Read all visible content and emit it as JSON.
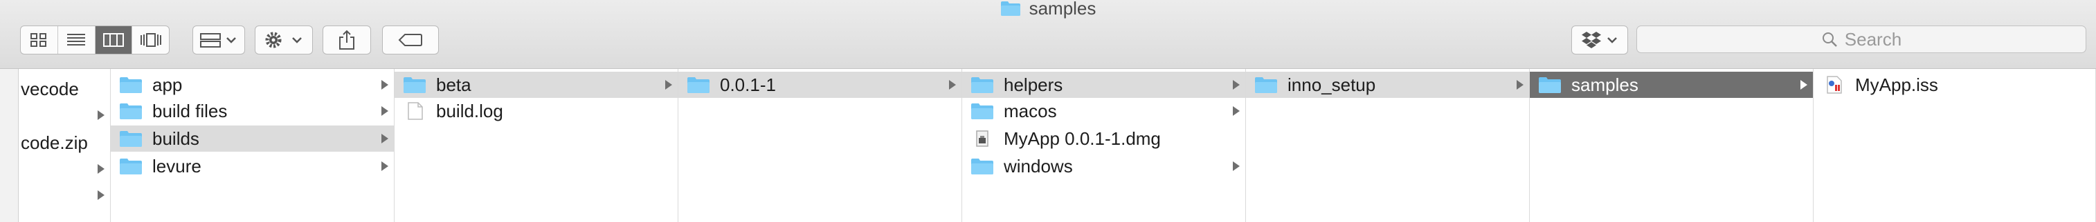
{
  "window": {
    "title": "samples"
  },
  "toolbar": {
    "views": [
      "icon-view",
      "list-view",
      "column-view",
      "cover-flow-view"
    ],
    "active_view": "column-view",
    "search_placeholder": "Search"
  },
  "columns": {
    "col0": [
      {
        "label": "vecode",
        "arrow": false
      },
      {
        "label": "",
        "arrow": true
      },
      {
        "label": "code.zip",
        "arrow": false
      },
      {
        "label": "",
        "arrow": true
      },
      {
        "label": "",
        "arrow": true
      }
    ],
    "col1": [
      {
        "label": "app",
        "icon": "folder-icon",
        "arrow": true
      },
      {
        "label": "build files",
        "icon": "folder-icon",
        "arrow": true
      },
      {
        "label": "builds",
        "icon": "folder-icon",
        "arrow": true,
        "selected": "gray"
      },
      {
        "label": "levure",
        "icon": "folder-icon",
        "arrow": true
      }
    ],
    "col2": [
      {
        "label": "beta",
        "icon": "folder-icon",
        "arrow": true,
        "selected": "gray"
      },
      {
        "label": "build.log",
        "icon": "document-icon",
        "arrow": false
      }
    ],
    "col3": [
      {
        "label": "0.0.1-1",
        "icon": "folder-icon",
        "arrow": true,
        "selected": "gray"
      }
    ],
    "col4": [
      {
        "label": "helpers",
        "icon": "folder-icon",
        "arrow": true,
        "selected": "gray"
      },
      {
        "label": "macos",
        "icon": "folder-icon",
        "arrow": true
      },
      {
        "label": "MyApp 0.0.1-1.dmg",
        "icon": "dmg-icon",
        "arrow": false
      },
      {
        "label": "windows",
        "icon": "folder-icon",
        "arrow": true
      }
    ],
    "col5": [
      {
        "label": "inno_setup",
        "icon": "folder-icon",
        "arrow": true,
        "selected": "gray"
      }
    ],
    "col6": [
      {
        "label": "samples",
        "icon": "folder-icon",
        "arrow": true,
        "selected": "dark"
      }
    ],
    "col7": [
      {
        "label": "MyApp.iss",
        "icon": "iss-file-icon",
        "arrow": false
      }
    ]
  },
  "colors": {
    "folder": "#6cc3f3",
    "selection_dark": "#707070",
    "selection_gray": "#dcdcdc"
  }
}
